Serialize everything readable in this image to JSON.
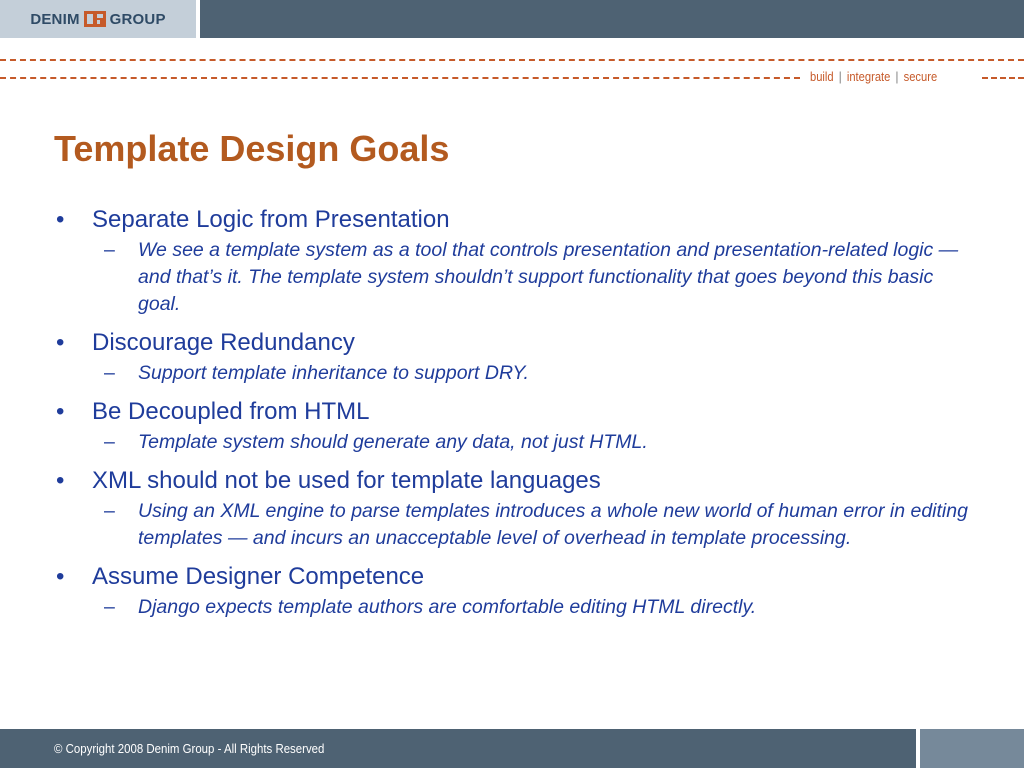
{
  "header": {
    "logo": {
      "left_word": "DENIM",
      "right_word": "GROUP"
    },
    "tagline": {
      "items": [
        "build",
        "integrate",
        "secure"
      ],
      "separator": "|"
    }
  },
  "slide": {
    "title": "Template Design Goals",
    "bullets": [
      {
        "text": "Separate Logic from Presentation",
        "sub": "We see a template system as a tool that controls presentation and presentation-related logic — and that’s it. The template system shouldn’t support functionality that goes beyond this basic goal."
      },
      {
        "text": "Discourage Redundancy",
        "sub": "Support template inheritance to support DRY."
      },
      {
        "text": "Be Decoupled from HTML",
        "sub": "Template system should generate any data, not just HTML."
      },
      {
        "text": "XML should not be used for template languages",
        "sub": "Using an XML engine to parse templates introduces a whole new world of human error in editing templates — and incurs an unacceptable level of overhead in template processing."
      },
      {
        "text": "Assume Designer Competence",
        "sub": "Django expects template authors are comfortable editing HTML directly."
      }
    ],
    "bullet_marker": "•",
    "sub_marker": "–"
  },
  "footer": {
    "copyright": "© Copyright 2008 Denim Group - All Rights Reserved"
  },
  "colors": {
    "bar": "#4e6273",
    "accent": "#c65a2a",
    "title": "#b35a1f",
    "body_text": "#1f3c9b"
  }
}
